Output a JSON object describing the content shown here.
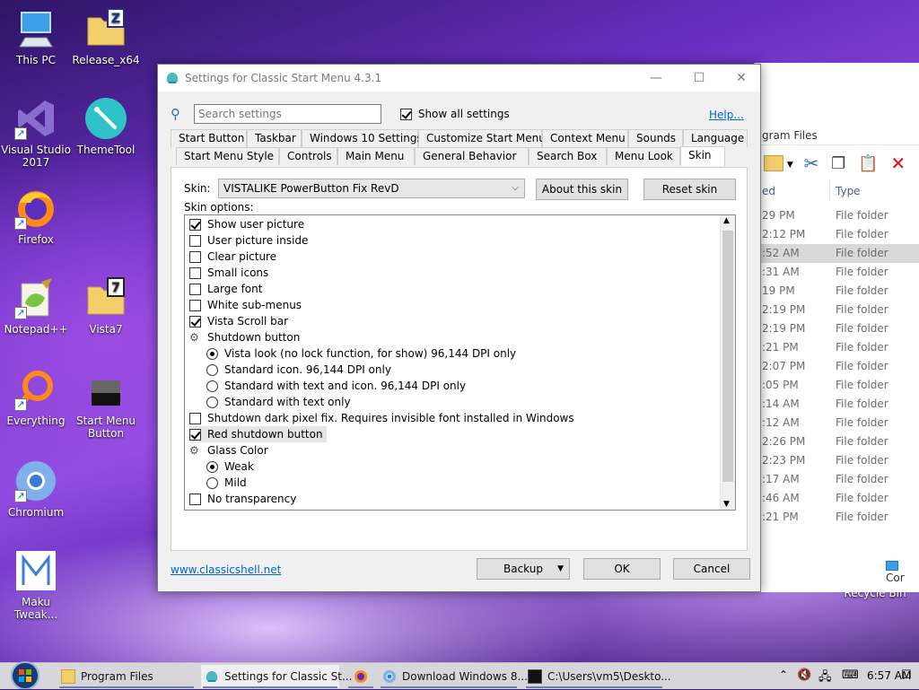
{
  "desktop": {
    "icons": [
      {
        "label": "This PC"
      },
      {
        "label": "Release_x64"
      },
      {
        "label": "Visual Studio 2017"
      },
      {
        "label": "ThemeTool"
      },
      {
        "label": "Firefox"
      },
      {
        "label": "Notepad++"
      },
      {
        "label": "Vista7"
      },
      {
        "label": "Everything"
      },
      {
        "label": "Start Menu Button"
      },
      {
        "label": "Chromium"
      },
      {
        "label": "Maku Tweak..."
      },
      {
        "label": "Recycle Bin"
      }
    ]
  },
  "explorer": {
    "address_fragment": "gram Files",
    "col_modified": "ed",
    "col_type": "Type",
    "rows": [
      {
        "time": "29 PM",
        "type": "File folder"
      },
      {
        "time": "2:12 PM",
        "type": "File folder"
      },
      {
        "time": ":52 AM",
        "type": "File folder",
        "selected": true
      },
      {
        "time": ":31 AM",
        "type": "File folder"
      },
      {
        "time": "19 PM",
        "type": "File folder"
      },
      {
        "time": "2:19 PM",
        "type": "File folder"
      },
      {
        "time": "2:19 PM",
        "type": "File folder"
      },
      {
        "time": ":21 PM",
        "type": "File folder"
      },
      {
        "time": "2:07 PM",
        "type": "File folder"
      },
      {
        "time": ":05 PM",
        "type": "File folder"
      },
      {
        "time": ":14 AM",
        "type": "File folder"
      },
      {
        "time": ":12 AM",
        "type": "File folder"
      },
      {
        "time": "2:26 PM",
        "type": "File folder"
      },
      {
        "time": "2:23 PM",
        "type": "File folder"
      },
      {
        "time": ":17 AM",
        "type": "File folder"
      },
      {
        "time": ":46 AM",
        "type": "File folder"
      },
      {
        "time": ":21 PM",
        "type": "File folder"
      }
    ],
    "status_fragment": "Cor"
  },
  "dialog": {
    "title": "Settings for Classic Start Menu 4.3.1",
    "search_placeholder": "Search settings",
    "show_all_label": "Show all settings",
    "show_all_checked": true,
    "help_link": "Help...",
    "tabs_row1": [
      "Start Button",
      "Taskbar",
      "Windows 10 Settings",
      "Customize Start Menu",
      "Context Menu",
      "Sounds",
      "Language"
    ],
    "tabs_row2": [
      "Start Menu Style",
      "Controls",
      "Main Menu",
      "General Behavior",
      "Search Box",
      "Menu Look",
      "Skin"
    ],
    "active_tab": "Skin",
    "skin_label": "Skin:",
    "skin_value": "VISTALIKE PowerButton Fix RevD",
    "about_button": "About this skin",
    "reset_button": "Reset skin",
    "options_label": "Skin options:",
    "options": [
      {
        "kind": "check",
        "label": "Show user picture",
        "checked": true,
        "indent": 0
      },
      {
        "kind": "check",
        "label": "User picture inside",
        "checked": false,
        "indent": 0
      },
      {
        "kind": "check",
        "label": "Clear picture",
        "checked": false,
        "indent": 0
      },
      {
        "kind": "check",
        "label": "Small icons",
        "checked": false,
        "indent": 0
      },
      {
        "kind": "check",
        "label": "Large font",
        "checked": false,
        "indent": 0
      },
      {
        "kind": "check",
        "label": "White sub-menus",
        "checked": false,
        "indent": 0
      },
      {
        "kind": "check",
        "label": "Vista Scroll bar",
        "checked": true,
        "indent": 0
      },
      {
        "kind": "group",
        "label": "Shutdown button",
        "indent": 0
      },
      {
        "kind": "radio",
        "label": "Vista look (no lock function, for show) 96,144 DPI only",
        "checked": true,
        "indent": 1
      },
      {
        "kind": "radio",
        "label": "Standard icon. 96,144 DPI only",
        "checked": false,
        "indent": 1
      },
      {
        "kind": "radio",
        "label": "Standard with text and icon. 96,144 DPI only",
        "checked": false,
        "indent": 1
      },
      {
        "kind": "radio",
        "label": "Standard with text only",
        "checked": false,
        "indent": 1
      },
      {
        "kind": "check",
        "label": "Shutdown dark pixel fix. Requires invisible font installed in Windows",
        "checked": false,
        "indent": 0
      },
      {
        "kind": "check",
        "label": "Red shutdown button",
        "checked": true,
        "indent": 0,
        "focused": true
      },
      {
        "kind": "group",
        "label": "Glass Color",
        "indent": 0
      },
      {
        "kind": "radio",
        "label": "Weak",
        "checked": true,
        "indent": 1
      },
      {
        "kind": "radio",
        "label": "Mild",
        "checked": false,
        "indent": 1
      },
      {
        "kind": "check",
        "label": "No transparency",
        "checked": false,
        "indent": 0
      }
    ],
    "website_link": "www.classicshell.net",
    "backup_button": "Backup",
    "ok_button": "OK",
    "cancel_button": "Cancel"
  },
  "taskbar": {
    "items": [
      {
        "label": "Program Files",
        "icon": "folder-icon"
      },
      {
        "label": "Settings for Classic St...",
        "icon": "shell-icon",
        "active": true
      },
      {
        "label": "",
        "icon": "firefox-icon"
      },
      {
        "label": "Download Windows 8....",
        "icon": "chromium-icon"
      },
      {
        "label": "C:\\Users\\vm5\\Deskto...",
        "icon": "console-icon"
      }
    ],
    "clock": "6:57 AM"
  }
}
